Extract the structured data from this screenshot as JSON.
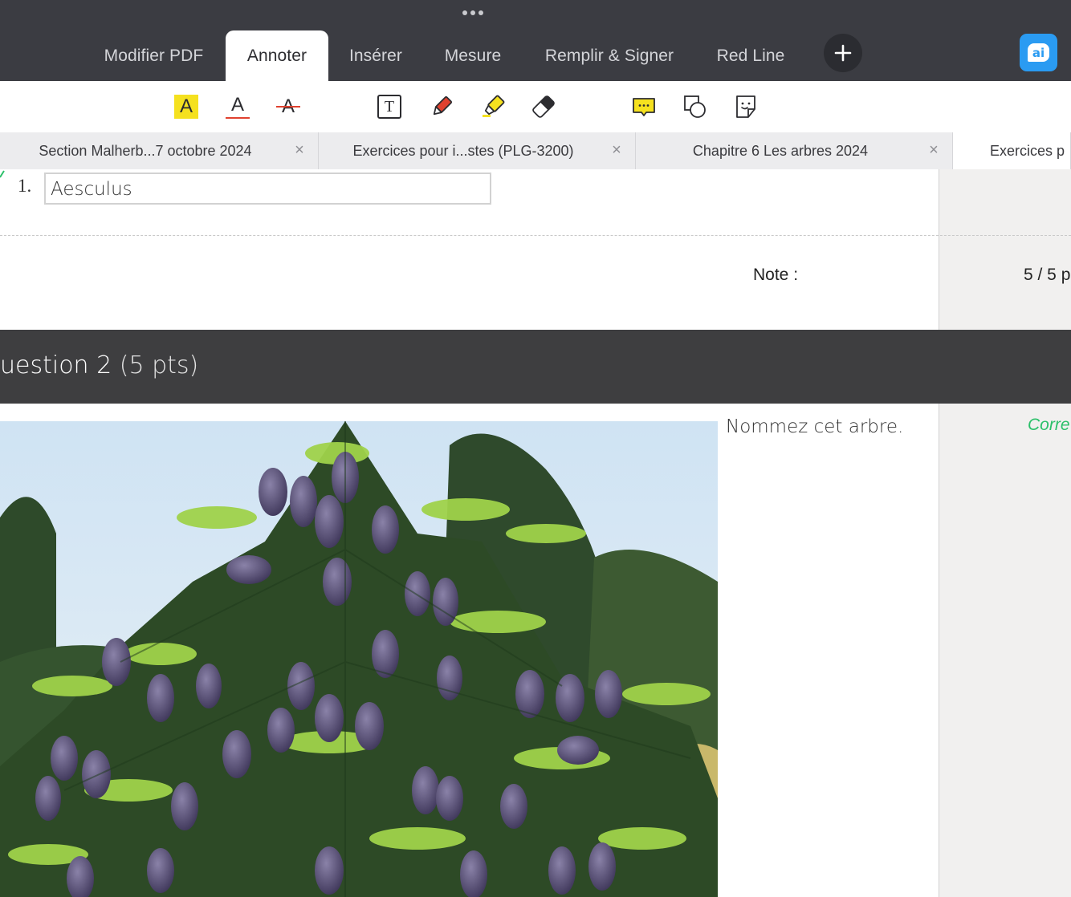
{
  "menu": {
    "tabs": [
      {
        "label": "Modifier PDF"
      },
      {
        "label": "Annoter",
        "active": true
      },
      {
        "label": "Insérer"
      },
      {
        "label": "Mesure"
      },
      {
        "label": "Remplir & Signer"
      },
      {
        "label": "Red Line"
      }
    ],
    "add_icon": "plus-icon",
    "ai_label": "ai"
  },
  "toolbar": {
    "tools": [
      {
        "name": "highlight-text",
        "letter": "A",
        "color": "#f5e11f"
      },
      {
        "name": "underline-text",
        "letter": "A",
        "color": "#e0412f"
      },
      {
        "name": "strikethrough-text",
        "letter": "A",
        "color": "#e0412f"
      },
      {
        "name": "text-box",
        "letter": "T"
      },
      {
        "name": "pen"
      },
      {
        "name": "highlighter"
      },
      {
        "name": "eraser"
      },
      {
        "name": "comment"
      },
      {
        "name": "shapes"
      },
      {
        "name": "sticker"
      }
    ]
  },
  "doc_tabs": [
    {
      "title": "Section Malherb...7 octobre 2024"
    },
    {
      "title": "Exercices pour i...stes (PLG-3200)"
    },
    {
      "title": "Chapitre 6 Les arbres  2024"
    },
    {
      "title": "Exercices p"
    }
  ],
  "document": {
    "answer_number": "1.",
    "answer_value": "Aesculus",
    "note_label": "Note :",
    "note_value": "5 / 5 p",
    "question_title": "uestion 2",
    "question_points": "(5 pts)",
    "prompt": "Nommez cet arbre.",
    "feedback": "Corre",
    "colors": {
      "accent_green": "#2cc06a",
      "band": "#3e3e40"
    }
  }
}
